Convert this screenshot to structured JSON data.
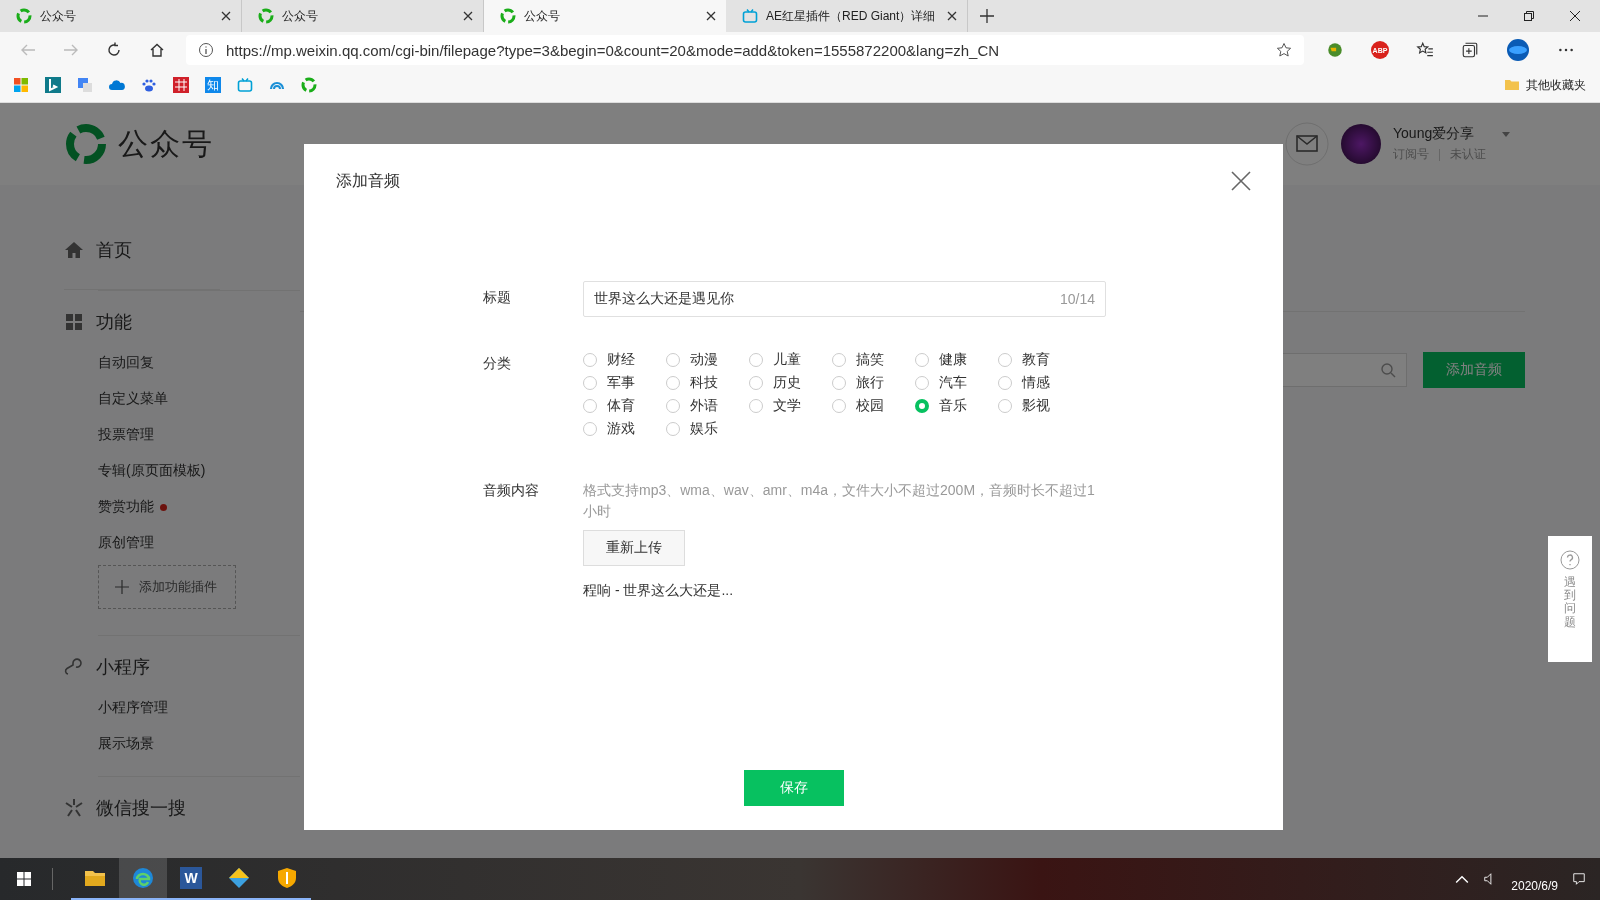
{
  "browser": {
    "tabs": [
      {
        "title": "公众号",
        "kind": "wechat",
        "selected": false
      },
      {
        "title": "公众号",
        "kind": "wechat",
        "selected": false
      },
      {
        "title": "公众号",
        "kind": "wechat",
        "selected": true
      },
      {
        "title": "AE红星插件（RED Giant）详细",
        "kind": "tv",
        "selected": false
      }
    ],
    "url": "https://mp.weixin.qq.com/cgi-bin/filepage?type=3&begin=0&count=20&mode=add&token=1555872200&lang=zh_CN",
    "extension_badge": "ABP",
    "bookmark_label": "知",
    "other_bookmarks": "其他收藏夹"
  },
  "header": {
    "logo_text": "公众号",
    "account_name": "Young爱分享",
    "account_type": "订阅号",
    "verification": "未认证"
  },
  "sidebar": {
    "sections": [
      {
        "kind": "home",
        "title": "首页"
      },
      {
        "kind": "grid",
        "title": "功能",
        "items": [
          {
            "label": "自动回复",
            "badge": false
          },
          {
            "label": "自定义菜单",
            "badge": false
          },
          {
            "label": "投票管理",
            "badge": false
          },
          {
            "label": "专辑(原页面模板)",
            "badge": false
          },
          {
            "label": "赞赏功能",
            "badge": true
          },
          {
            "label": "原创管理",
            "badge": false
          }
        ],
        "add_plugin": "添加功能插件"
      },
      {
        "kind": "link",
        "title": "小程序",
        "items": [
          {
            "label": "小程序管理",
            "badge": false
          },
          {
            "label": "展示场景",
            "badge": false
          }
        ]
      },
      {
        "kind": "search",
        "title": "微信搜一搜"
      }
    ]
  },
  "main": {
    "add_button": "添加音频"
  },
  "dialog": {
    "title": "添加音频",
    "title_label": "标题",
    "title_value": "世界这么大还是遇见你",
    "counter": "10/14",
    "category_label": "分类",
    "categories": [
      {
        "label": "财经",
        "selected": false
      },
      {
        "label": "动漫",
        "selected": false
      },
      {
        "label": "儿童",
        "selected": false
      },
      {
        "label": "搞笑",
        "selected": false
      },
      {
        "label": "健康",
        "selected": false
      },
      {
        "label": "教育",
        "selected": false
      },
      {
        "label": "军事",
        "selected": false
      },
      {
        "label": "科技",
        "selected": false
      },
      {
        "label": "历史",
        "selected": false
      },
      {
        "label": "旅行",
        "selected": false
      },
      {
        "label": "汽车",
        "selected": false
      },
      {
        "label": "情感",
        "selected": false
      },
      {
        "label": "体育",
        "selected": false
      },
      {
        "label": "外语",
        "selected": false
      },
      {
        "label": "文学",
        "selected": false
      },
      {
        "label": "校园",
        "selected": false
      },
      {
        "label": "音乐",
        "selected": true
      },
      {
        "label": "影视",
        "selected": false
      },
      {
        "label": "游戏",
        "selected": false
      },
      {
        "label": "娱乐",
        "selected": false
      }
    ],
    "content_label": "音频内容",
    "hint": "格式支持mp3、wma、wav、amr、m4a，文件大小不超过200M，音频时长不超过1小时",
    "upload_button": "重新上传",
    "file_name": "程响 - 世界这么大还是...",
    "save_button": "保存"
  },
  "help": {
    "label": "遇到问题"
  },
  "taskbar": {
    "word_label": "W",
    "date": "2020/6/9"
  }
}
